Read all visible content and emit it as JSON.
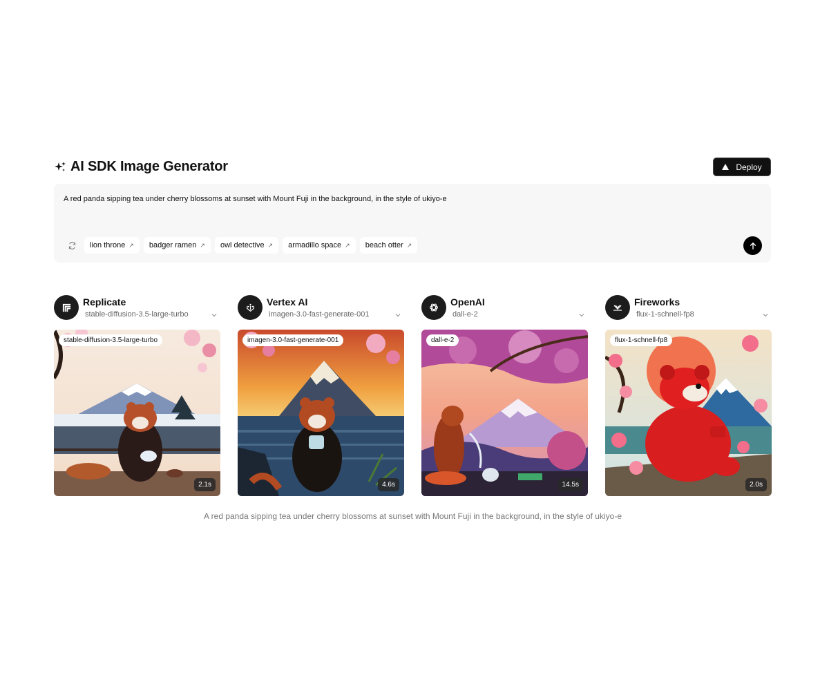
{
  "header": {
    "title": "AI SDK Image Generator",
    "deploy_label": "Deploy"
  },
  "prompt": {
    "text": "A red panda sipping tea under cherry blossoms at sunset with Mount Fuji in the background, in the style of ukiyo-e",
    "suggestions": [
      "lion throne",
      "badger ramen",
      "owl detective",
      "armadillo space",
      "beach otter"
    ]
  },
  "providers": [
    {
      "name": "Replicate",
      "model": "stable-diffusion-3.5-large-turbo",
      "time": "2.1s"
    },
    {
      "name": "Vertex AI",
      "model": "imagen-3.0-fast-generate-001",
      "time": "4.6s"
    },
    {
      "name": "OpenAI",
      "model": "dall-e-2",
      "time": "14.5s"
    },
    {
      "name": "Fireworks",
      "model": "flux-1-schnell-fp8",
      "time": "2.0s"
    }
  ],
  "caption": "A red panda sipping tea under cherry blossoms at sunset with Mount Fuji in the background, in the style of ukiyo-e",
  "colors": {
    "accent": "#000000",
    "prompt_bg": "#f7f7f7",
    "icon_bg": "#1c1c1c"
  }
}
